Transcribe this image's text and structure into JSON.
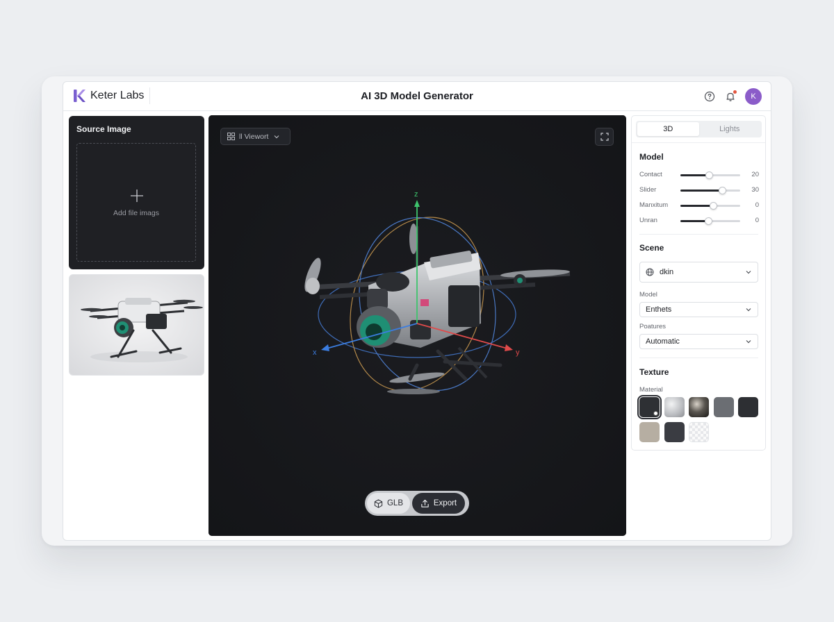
{
  "brand": {
    "name": "Keter Labs",
    "logo_color": "#8b6cd8"
  },
  "header": {
    "title": "AI 3D Model Generator",
    "help_icon": "help-circle-icon",
    "bell_icon": "bell-icon",
    "notification_dot_color": "#e2543e",
    "avatar_initial": "K",
    "avatar_color": "#8b5cc9"
  },
  "source": {
    "title": "Source Image",
    "drop_text": "Add file imags",
    "thumbnail_alt": "drone photo"
  },
  "viewport": {
    "select_label": "ll Viewort",
    "axes": {
      "x": "x",
      "y": "y",
      "z": "z"
    },
    "axis_colors": {
      "x": "#3b7de0",
      "y": "#e04a4a",
      "z": "#3ec46d"
    },
    "glb_label": "GLB",
    "export_label": "Export"
  },
  "panel": {
    "tabs": [
      {
        "label": "3D",
        "active": true
      },
      {
        "label": "Lights",
        "active": false
      }
    ],
    "model": {
      "title": "Model",
      "sliders": [
        {
          "label": "Contact",
          "value": "20",
          "level": 0.48
        },
        {
          "label": "Slider",
          "value": "30",
          "level": 0.7
        },
        {
          "label": "Manxitum",
          "value": "0",
          "level": 0.55
        },
        {
          "label": "Unran",
          "value": "0",
          "level": 0.46
        }
      ]
    },
    "scene": {
      "title": "Scene",
      "environment_value": "dkin",
      "model_label": "Model",
      "model_value": "Enthets",
      "features_label": "Poatures",
      "features_value": "Automatic"
    },
    "texture": {
      "title": "Texture",
      "material_label": "Material",
      "swatches": [
        {
          "name": "dark-matte",
          "color": "#2e3034",
          "selected": true
        },
        {
          "name": "brushed-silver",
          "color": "#b9bbbf"
        },
        {
          "name": "dark-chrome",
          "color": "#5a5650"
        },
        {
          "name": "slate-gray",
          "color": "#6b6e73"
        },
        {
          "name": "black-fabric",
          "color": "#2d2f33"
        },
        {
          "name": "beige-stone",
          "color": "#b6aea2"
        },
        {
          "name": "charcoal",
          "color": "#3a3c42"
        },
        {
          "name": "transparent",
          "color": "#f0f0f0"
        }
      ]
    }
  }
}
